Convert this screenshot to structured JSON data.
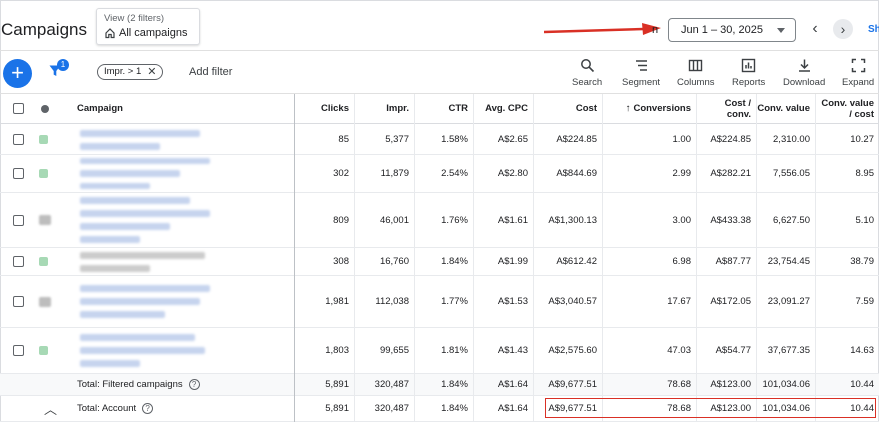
{
  "header": {
    "title": "Campaigns",
    "view": {
      "label": "View (2 filters)",
      "value": "All campaigns"
    },
    "date_partial": "n",
    "date_range": "Jun 1 – 30, 2025",
    "edge_text": "Sh"
  },
  "toolbar": {
    "filter_count": "1",
    "chip_label": "Impr. > 1",
    "add_filter": "Add filter",
    "tools": [
      "Search",
      "Segment",
      "Columns",
      "Reports",
      "Download",
      "Expand"
    ]
  },
  "table": {
    "columns": [
      "Campaign",
      "Clicks",
      "Impr.",
      "CTR",
      "Avg. CPC",
      "Cost",
      "Conversions",
      "Cost / conv.",
      "Conv. value",
      "Conv. value / cost"
    ],
    "rows": [
      {
        "clicks": "85",
        "impr": "5,377",
        "ctr": "1.58%",
        "cpc": "A$2.65",
        "cost": "A$224.85",
        "conv": "1.00",
        "cpc_conv": "A$224.85",
        "conv_value": "2,310.00",
        "value_cost": "10.27"
      },
      {
        "clicks": "302",
        "impr": "11,879",
        "ctr": "2.54%",
        "cpc": "A$2.80",
        "cost": "A$844.69",
        "conv": "2.99",
        "cpc_conv": "A$282.21",
        "conv_value": "7,556.05",
        "value_cost": "8.95"
      },
      {
        "clicks": "809",
        "impr": "46,001",
        "ctr": "1.76%",
        "cpc": "A$1.61",
        "cost": "A$1,300.13",
        "conv": "3.00",
        "cpc_conv": "A$433.38",
        "conv_value": "6,627.50",
        "value_cost": "5.10"
      },
      {
        "clicks": "308",
        "impr": "16,760",
        "ctr": "1.84%",
        "cpc": "A$1.99",
        "cost": "A$612.42",
        "conv": "6.98",
        "cpc_conv": "A$87.77",
        "conv_value": "23,754.45",
        "value_cost": "38.79"
      },
      {
        "clicks": "1,981",
        "impr": "112,038",
        "ctr": "1.77%",
        "cpc": "A$1.53",
        "cost": "A$3,040.57",
        "conv": "17.67",
        "cpc_conv": "A$172.05",
        "conv_value": "23,091.27",
        "value_cost": "7.59"
      },
      {
        "clicks": "1,803",
        "impr": "99,655",
        "ctr": "1.81%",
        "cpc": "A$1.43",
        "cost": "A$2,575.60",
        "conv": "47.03",
        "cpc_conv": "A$54.77",
        "conv_value": "37,677.35",
        "value_cost": "14.63"
      }
    ],
    "total_filtered": {
      "label": "Total: Filtered campaigns",
      "clicks": "5,891",
      "impr": "320,487",
      "ctr": "1.84%",
      "cpc": "A$1.64",
      "cost": "A$9,677.51",
      "conv": "78.68",
      "cpc_conv": "A$123.00",
      "conv_value": "101,034.06",
      "value_cost": "10.44"
    },
    "total_account": {
      "label": "Total: Account",
      "clicks": "5,891",
      "impr": "320,487",
      "ctr": "1.84%",
      "cpc": "A$1.64",
      "cost": "A$9,677.51",
      "conv": "78.68",
      "cpc_conv": "A$123.00",
      "conv_value": "101,034.06",
      "value_cost": "10.44"
    }
  },
  "colors": {
    "accent": "#1a73e8",
    "highlight": "#d93025"
  }
}
